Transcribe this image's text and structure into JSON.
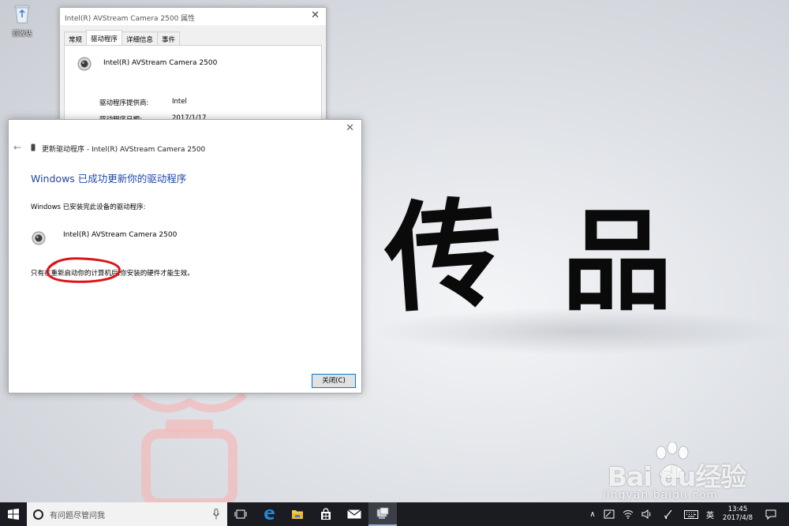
{
  "desktop": {
    "recycle_bin_label": "回收站",
    "calligraphy": [
      "传",
      "品"
    ]
  },
  "properties_window": {
    "title": "Intel(R) AVStream Camera 2500 属性",
    "tabs": [
      "常规",
      "驱动程序",
      "详细信息",
      "事件"
    ],
    "active_tab": "驱动程序",
    "device_name": "Intel(R) AVStream Camera 2500",
    "rows": [
      {
        "label": "驱动程序提供商:",
        "value": "Intel"
      },
      {
        "label": "驱动程序日期:",
        "value": "2017/1/17"
      }
    ]
  },
  "update_dialog": {
    "header": "更新驱动程序 - Intel(R) AVStream Camera 2500",
    "headline": "Windows 已成功更新你的驱动程序",
    "installed_text": "Windows 已安装完此设备的驱动程序:",
    "device_name": "Intel(R) AVStream Camera 2500",
    "restart_note": "只有在重新启动你的计算机后,你安装的硬件才能生效。",
    "close_button": "关闭(C)",
    "annotation_color": "#d9151b"
  },
  "taskbar": {
    "search_placeholder": "有问题尽管问我",
    "apps": [
      "task-view",
      "edge",
      "file-explorer",
      "store",
      "mail",
      "device-manager"
    ],
    "ime": "英",
    "time": "13:45",
    "date": "2017/4/8"
  },
  "watermark": {
    "brand": "Bai du经验",
    "url": "jingyan.baidu.com"
  },
  "colors": {
    "accent": "#0078d7",
    "headline": "#1d47a8",
    "taskbar": "#1a1c22"
  }
}
